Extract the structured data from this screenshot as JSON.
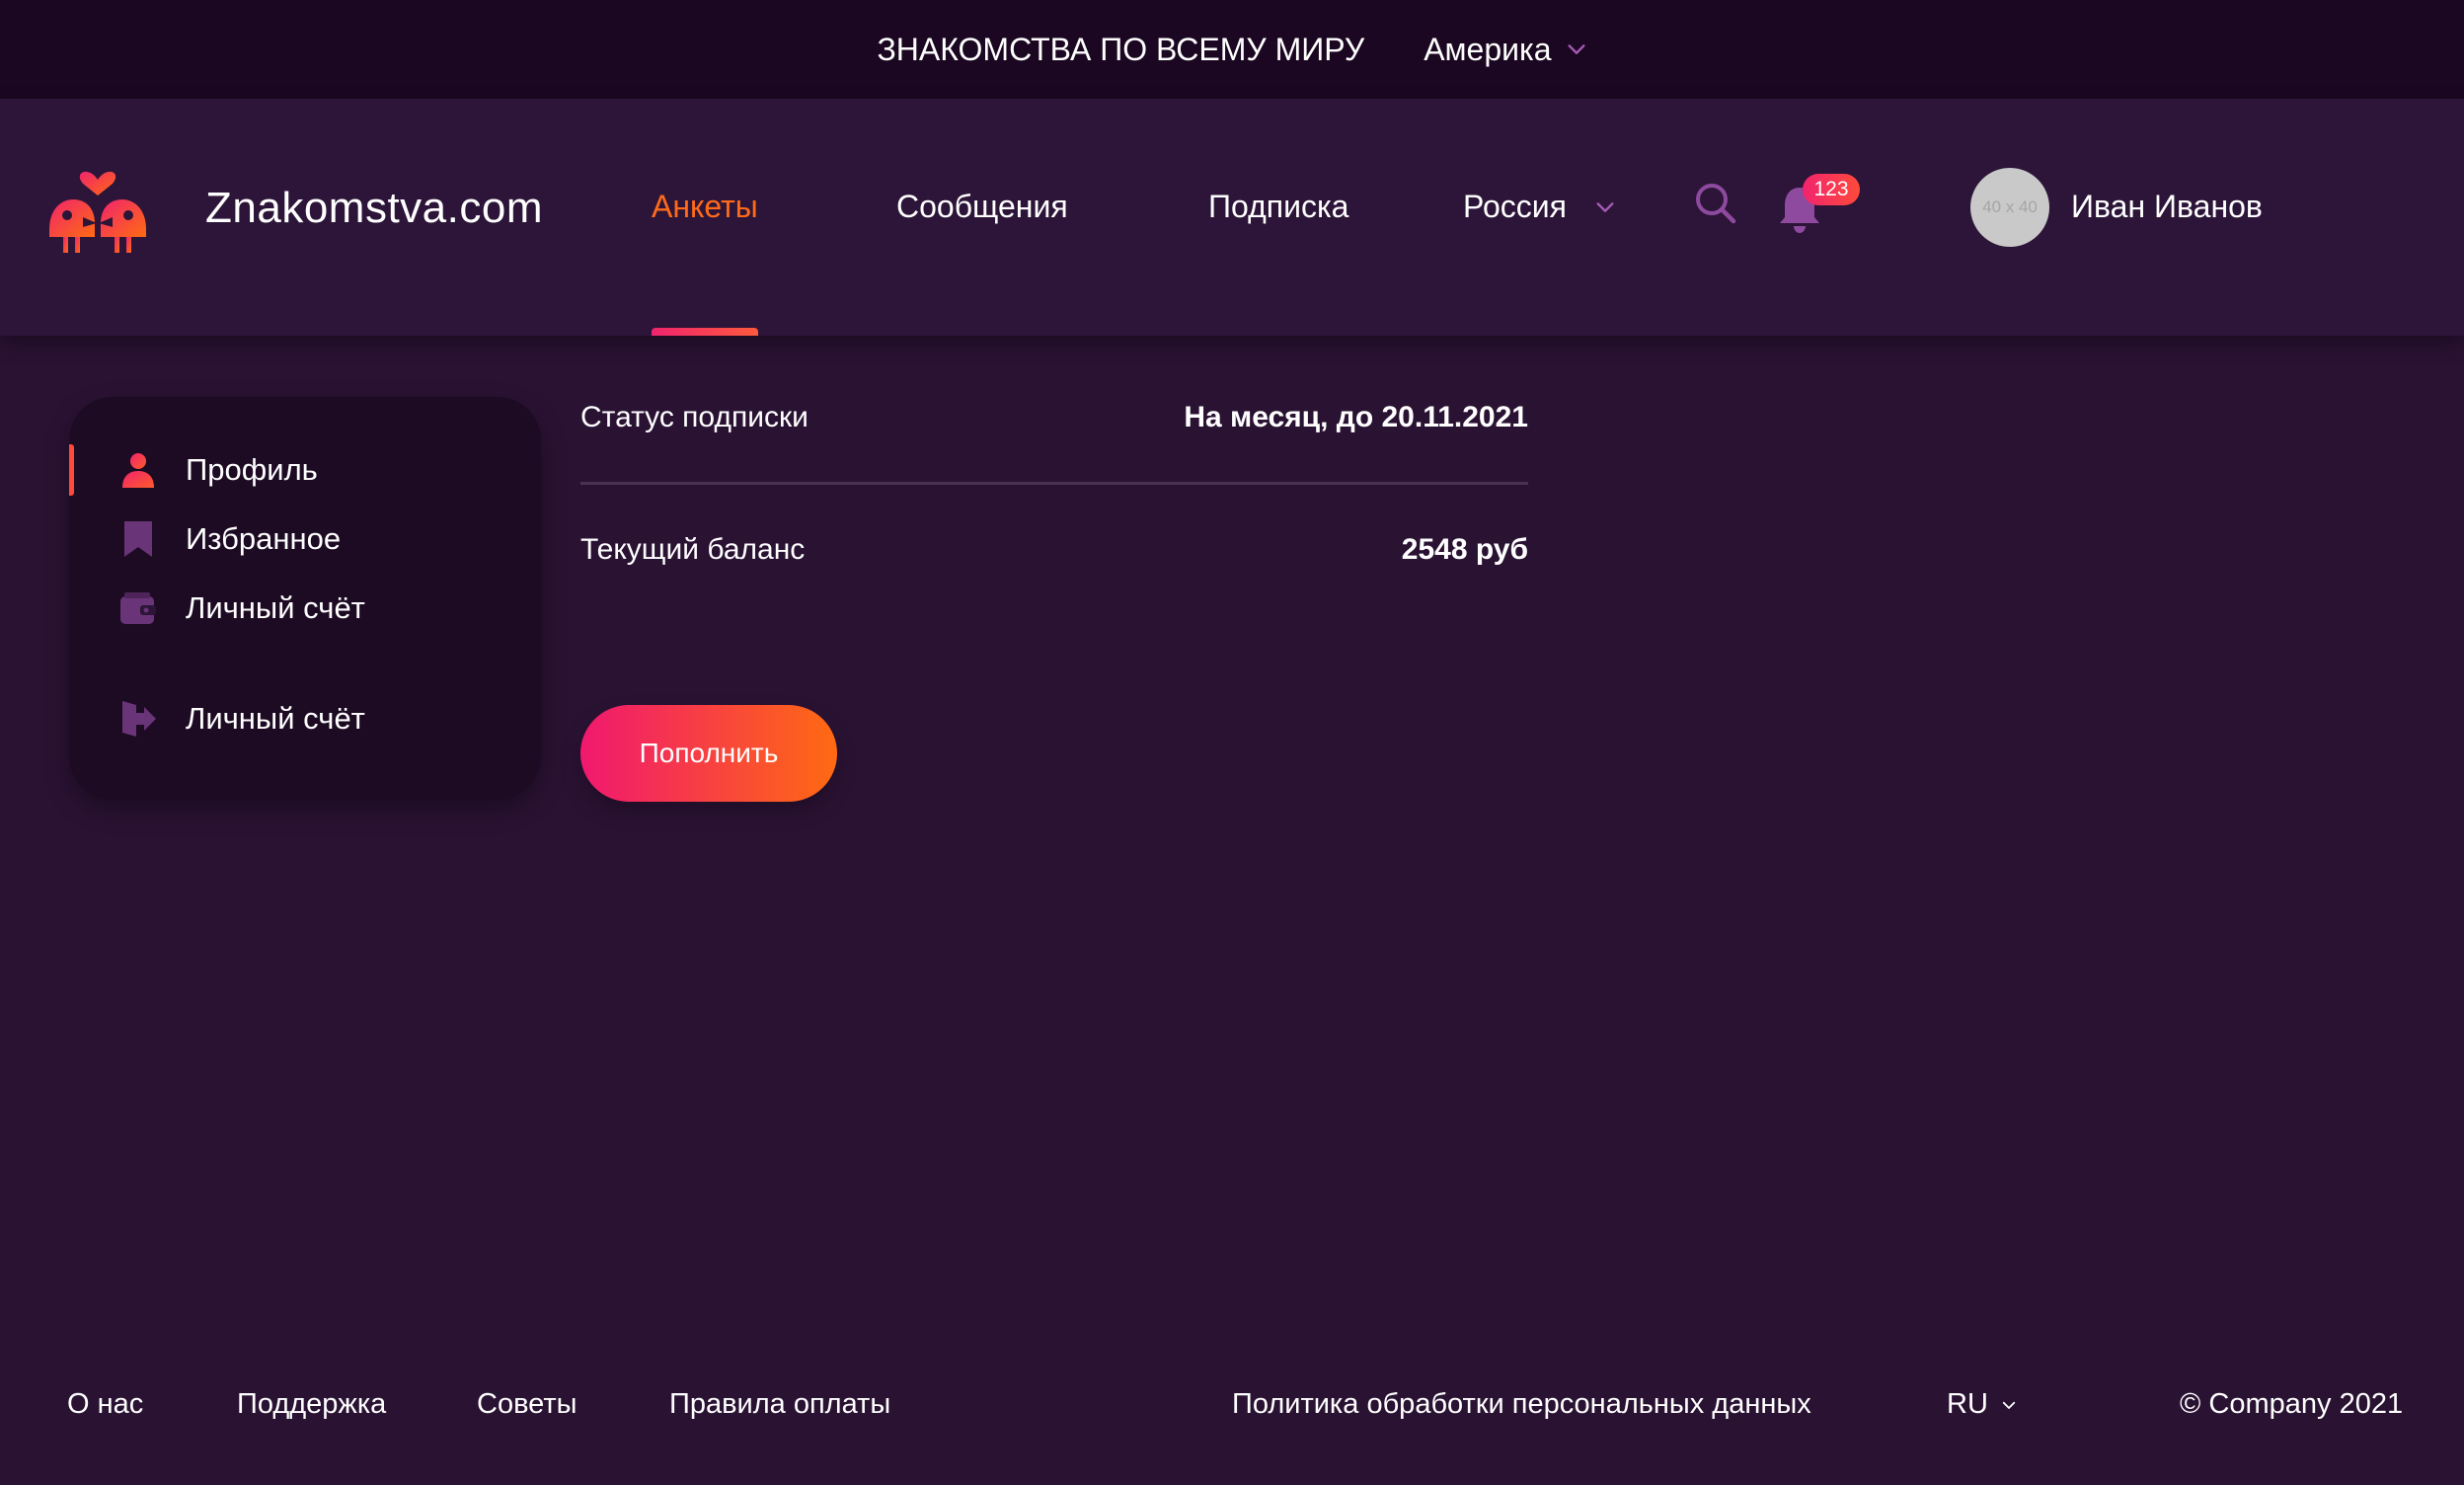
{
  "top_bar": {
    "title": "ЗНАКОМСТВА ПО ВСЕМУ МИРУ",
    "region": "Америка"
  },
  "header": {
    "logo_text": "Znakomstva.com",
    "nav": [
      "Анкеты",
      "Сообщения",
      "Подписка"
    ],
    "country": "Россия",
    "notifications": "123",
    "avatar_placeholder": "40 x 40",
    "user_name": "Иван Иванов"
  },
  "sidebar": {
    "items": [
      "Профиль",
      "Избранное",
      "Личный счёт",
      "Личный счёт"
    ]
  },
  "main": {
    "subscription_label": "Статус подписки",
    "subscription_value": "На месяц, до 20.11.2021",
    "balance_label": "Текущий баланс",
    "balance_value": "2548 руб",
    "topup_button": "Пополнить"
  },
  "footer": {
    "links": [
      "О нас",
      "Поддержка",
      "Советы",
      "Правила оплаты",
      "Политика обработки персональных данных"
    ],
    "language": "RU",
    "copyright": "© Company 2021"
  },
  "colors": {
    "accent_orange": "#ff6a1a",
    "accent_pink": "#f0246e",
    "background": "#2a1233",
    "icon_purple": "#7a3f8a"
  }
}
